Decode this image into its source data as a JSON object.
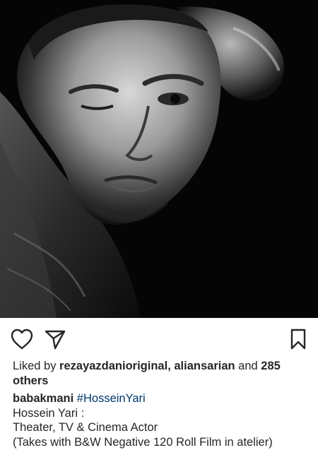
{
  "post": {
    "likes": {
      "prefix": "Liked by ",
      "user1": "rezayazdanioriginal",
      "separator": ", ",
      "user2": "aliansarian",
      "and_text": " and ",
      "count": "285",
      "others": "others"
    },
    "caption": {
      "username": "babakmani",
      "hashtag": "#HosseinYari",
      "lines": [
        "Hossein Yari :",
        "Theater, TV & Cinema Actor",
        "(Takes with B&W Negative 120 Roll Film in atelier)"
      ]
    },
    "icons": {
      "like": "heart-outline-icon",
      "share": "paper-plane-icon",
      "save": "bookmark-outline-icon"
    }
  }
}
